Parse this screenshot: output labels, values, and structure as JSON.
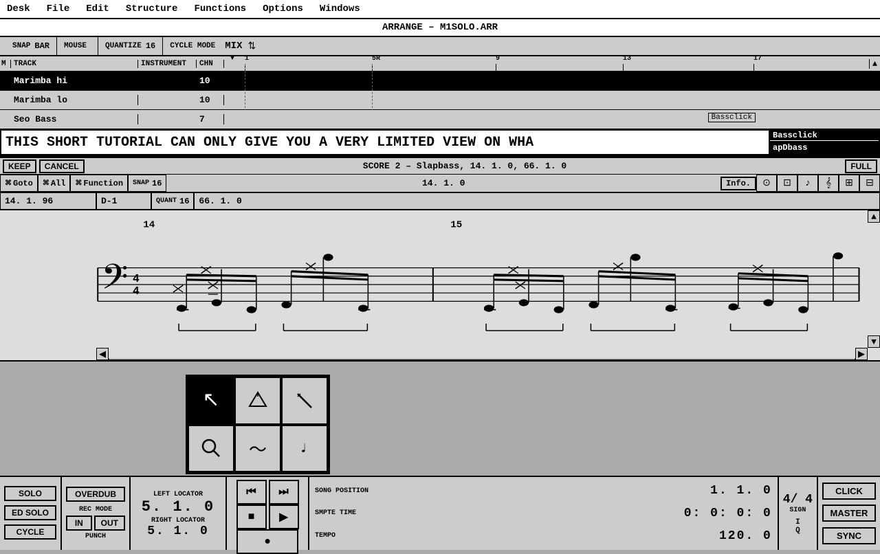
{
  "menubar": {
    "items": [
      "Desk",
      "File",
      "Edit",
      "Structure",
      "Functions",
      "Options",
      "Windows"
    ]
  },
  "titlebar": {
    "title": "ARRANGE – M1SOLO.ARR"
  },
  "toolbar": {
    "snap_label": "SNAP",
    "snap_value": "BAR",
    "mouse_label": "MOUSE",
    "quantize_label": "QUANTIZE",
    "quantize_value": "16",
    "cycle_mode_label": "CYCLE MODE",
    "cycle_mode_value": "MIX"
  },
  "track_header": {
    "m": "M",
    "track": "TRACK",
    "instrument": "INSTRUMENT",
    "chn": "CHN"
  },
  "tracks": [
    {
      "name": "Marimba hi",
      "instrument": "",
      "chn": "10",
      "selected": true
    },
    {
      "name": "Marimba lo",
      "instrument": "",
      "chn": "10",
      "selected": false
    },
    {
      "name": "Seo Bass",
      "instrument": "",
      "chn": "7",
      "selected": false
    }
  ],
  "ruler_marks": [
    "1",
    "5R",
    "9",
    "13",
    "17"
  ],
  "marquee_text": "THIS SHORT TUTORIAL CAN ONLY GIVE YOU A VERY LIMITED VIEW ON WHA",
  "bassclick_label": "Bassclick",
  "appbass_label": "apDbass",
  "score": {
    "keep_btn": "KEEP",
    "cancel_btn": "CANCEL",
    "title": "SCORE 2 – Slapbass,   14. 1.  0,   66. 1.  0",
    "full_btn": "FULL",
    "goto_prefix": "⌘",
    "goto_label": "Goto",
    "all_prefix": "⌘",
    "all_label": "All",
    "function_prefix": "⌘",
    "function_label": "Function",
    "snap_label": "SNAP",
    "snap_val": "16",
    "pos1": "14. 1.  0",
    "quant_label": "QUANT",
    "quant_val": "16",
    "pos2": "66. 1.  0",
    "pos_display": "14. 1. 96",
    "note_display": "D-1",
    "info_btn": "Info.",
    "up_arrow": "▲",
    "down_arrow": "▼",
    "left_arrow": "◀",
    "right_arrow": "▶"
  },
  "tools": [
    {
      "name": "pointer",
      "symbol": "↖",
      "selected": true
    },
    {
      "name": "pencil",
      "symbol": "✏",
      "selected": false
    },
    {
      "name": "eraser",
      "symbol": "✗",
      "selected": false
    },
    {
      "name": "magnifier",
      "symbol": "🔍",
      "selected": false
    },
    {
      "name": "bend",
      "symbol": "⌒",
      "selected": false
    },
    {
      "name": "note",
      "symbol": "♩",
      "selected": false
    }
  ],
  "transport": {
    "solo_btn": "SOLO",
    "ed_solo_btn": "ED SOLO",
    "cycle_btn": "CYCLE",
    "overdub_btn": "OVERDUB",
    "rec_mode_label": "REC MODE",
    "punch_in": "IN",
    "punch_out": "OUT",
    "punch_label": "PUNCH",
    "left_locator_label": "LEFT LOCATOR",
    "left_locator_value": "5. 1.  0",
    "right_locator_label": "RIGHT LOCATOR",
    "right_locator_value": "5. 1.  0",
    "rewind_btn": "⏮",
    "back_btn": "◀◀",
    "fforward_btn": "▶▶",
    "stop_btn": "■",
    "play_btn": "▶",
    "record_btn": "●",
    "song_position_label": "SONG POSITION",
    "song_position_value": "1. 1.  0",
    "sign_label": "SIGN",
    "sign_value": "4/ 4",
    "i_label": "I",
    "smpte_label": "SMPTE TIME",
    "smpte_value": "0: 0: 0: 0",
    "tempo_label": "TEMPO",
    "tempo_value": "120.  0",
    "q_label": "Q",
    "click_btn": "CLICK",
    "master_btn": "MASTER",
    "sync_btn": "SYNC"
  }
}
